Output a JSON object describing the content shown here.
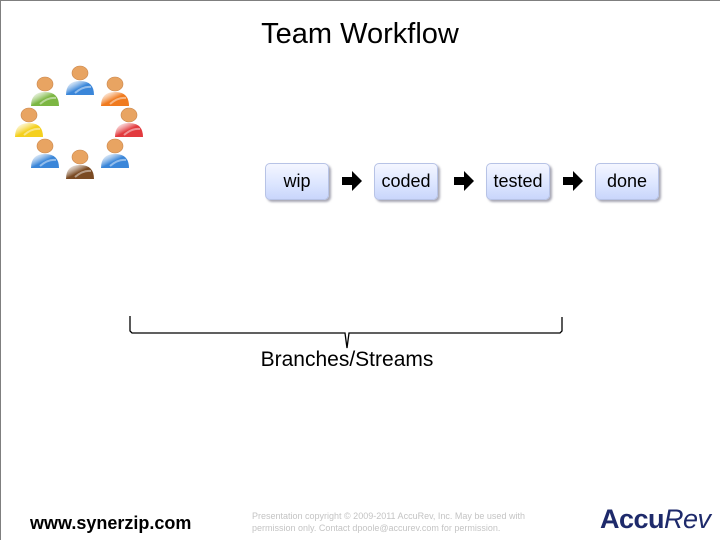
{
  "slide": {
    "title": "Team Workflow",
    "team_icon": {
      "name": "team-people-circle-icon",
      "people_colors": [
        "#3a86d9",
        "#f07a1e",
        "#e23a3e",
        "#3a86d9",
        "#7a4a22",
        "#3a86d9",
        "#f4d01e",
        "#7cb642"
      ]
    },
    "workflow": {
      "stages": [
        {
          "label": "wip"
        },
        {
          "label": "coded"
        },
        {
          "label": "tested"
        },
        {
          "label": "done"
        }
      ],
      "arrow_icon": "right-arrow-icon",
      "stage_gradient": [
        "#f4f6ff",
        "#c9d6fb"
      ]
    },
    "bracket_label": "Branches/Streams",
    "footer": {
      "url": "www.synerzip.com",
      "copyright_line1": "Presentation copyright © 2009-2011 AccuRev, Inc. May be used with",
      "copyright_line2": "permission only. Contact dpoole@accurev.com for permission.",
      "logo_part1": "Accu",
      "logo_part2": "Rev",
      "logo_color": "#1e2a6b"
    }
  }
}
